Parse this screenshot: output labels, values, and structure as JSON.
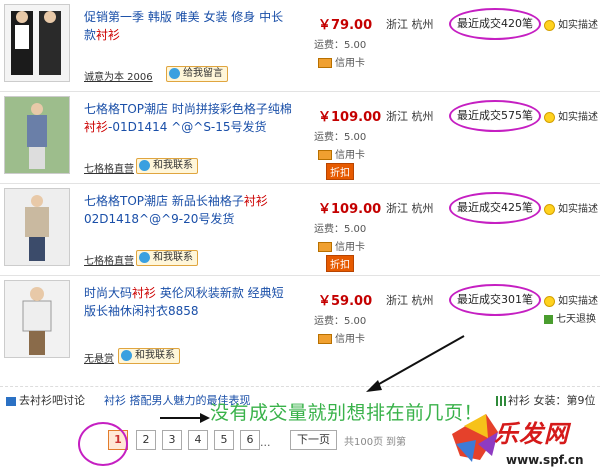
{
  "items": [
    {
      "title_pre": "促销第一季 韩版 唯美 女装 修身 中长款",
      "title_hl": "衬衫",
      "title_post": "",
      "seller": "诚意为本 2006",
      "ww_label": "给我留言",
      "price": "￥79.00",
      "shipping": "运费：5.00",
      "credit": "信用卡",
      "discount": "",
      "location": "浙江 杭州",
      "sold": "最近成交420笔",
      "desc": "如实描述",
      "desc2": ""
    },
    {
      "title_pre": "七格格TOP潮店 时尚拼接彩色格子纯棉",
      "title_hl": "衬衫",
      "title_post": "-01D1414 ^@^S-15号发货",
      "seller": "七格格直营",
      "ww_label": "和我联系",
      "price": "￥109.00",
      "shipping": "运费：5.00",
      "credit": "信用卡",
      "discount": "折扣",
      "location": "浙江 杭州",
      "sold": "最近成交575笔",
      "desc": "如实描述",
      "desc2": ""
    },
    {
      "title_pre": "七格格TOP潮店 新品长袖格子",
      "title_hl": "衬衫",
      "title_post": " 02D1418^@^9-20号发货",
      "seller": "七格格直营",
      "ww_label": "和我联系",
      "price": "￥109.00",
      "shipping": "运费：5.00",
      "credit": "信用卡",
      "discount": "折扣",
      "location": "浙江 杭州",
      "sold": "最近成交425笔",
      "desc": "如实描述",
      "desc2": ""
    },
    {
      "title_pre": "时尚大码",
      "title_hl": "衬衫",
      "title_post": " 英伦风秋装新款 经典短版长袖休闲衬衣8858",
      "seller": "无悬赏",
      "ww_label": "和我联系",
      "price": "￥59.00",
      "shipping": "运费：5.00",
      "credit": "信用卡",
      "discount": "",
      "location": "浙江 杭州",
      "sold": "最近成交301笔",
      "desc": "如实描述",
      "desc2": "七天退换"
    }
  ],
  "bottom": {
    "discuss": "去衬衫吧讨论",
    "link": "衬衫 搭配男人魅力的最佳表现",
    "right": "衬衫  女装：第9位"
  },
  "pager": {
    "pages": [
      "1",
      "2",
      "3",
      "4",
      "5",
      "6"
    ],
    "current": "1",
    "dots": "...",
    "next": "下一页",
    "total": "共100页",
    "goto": "到第"
  },
  "annotation": "没有成交量就别想排在前几页！",
  "watermark": {
    "text": "乐发网",
    "url": "www.spf.cn"
  },
  "colors": {
    "highlight_circle": "#c51fc2",
    "price": "#c40000",
    "title_link": "#1a4fa8",
    "annotation": "#39b24a"
  }
}
